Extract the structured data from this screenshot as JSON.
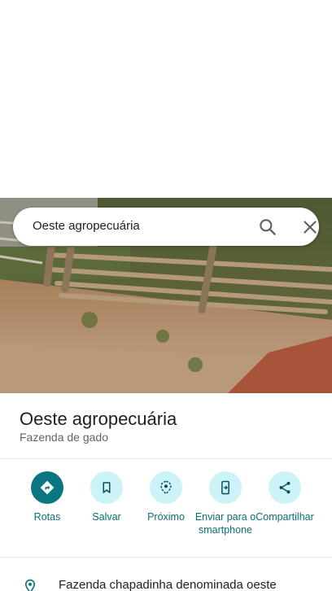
{
  "search": {
    "query": "Oeste agropecuária"
  },
  "place": {
    "name": "Oeste agropecuária",
    "category": "Fazenda de gado"
  },
  "actions": [
    {
      "label": "Rotas",
      "icon": "directions-icon"
    },
    {
      "label": "Salvar",
      "icon": "bookmark-icon"
    },
    {
      "label": "Próximo",
      "icon": "nearby-icon"
    },
    {
      "label": "Enviar para o smartphone",
      "icon": "send-to-phone-icon"
    },
    {
      "label": "Compartilhar",
      "icon": "share-icon"
    }
  ],
  "address": {
    "text": "Fazenda chapadinha denominada oeste",
    "icon": "location-pin-icon"
  },
  "colors": {
    "accent": "#0a7682",
    "accent_light": "#ccf3f8",
    "action_label": "#0a6d78"
  }
}
